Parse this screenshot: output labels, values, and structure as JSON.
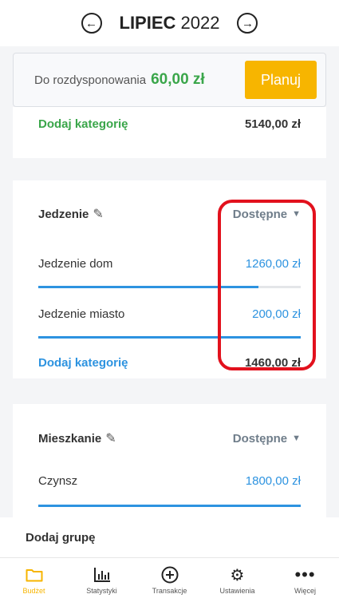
{
  "header": {
    "month": "LIPIEC",
    "year": "2022",
    "prev_icon": "arrow-left-circle-icon",
    "next_icon": "arrow-right-circle-icon"
  },
  "budget": {
    "label": "Do rozdysponowania",
    "amount": "60,00 zł",
    "plan_button": "Planuj"
  },
  "top_card": {
    "add_category": "Dodaj kategorię",
    "total": "5140,00 zł"
  },
  "groups": [
    {
      "name": "Jedzenie",
      "column_label": "Dostępne",
      "categories": [
        {
          "name": "Jedzenie dom",
          "amount": "1260,00 zł",
          "progress": 0.84
        },
        {
          "name": "Jedzenie miasto",
          "amount": "200,00 zł",
          "progress": 1.0
        }
      ],
      "add_category": "Dodaj kategorię",
      "total": "1460,00 zł"
    },
    {
      "name": "Mieszkanie",
      "column_label": "Dostępne",
      "categories": [
        {
          "name": "Czynsz",
          "amount": "1800,00 zł",
          "progress": 1.0
        }
      ]
    }
  ],
  "add_group": "Dodaj grupę",
  "tabs": [
    {
      "label": "Budżet",
      "icon": "folder-icon",
      "active": true
    },
    {
      "label": "Statystyki",
      "icon": "bar-chart-icon",
      "active": false
    },
    {
      "label": "Transakcje",
      "icon": "plus-circle-icon",
      "active": false
    },
    {
      "label": "Ustawienia",
      "icon": "gear-icon",
      "active": false
    },
    {
      "label": "Więcej",
      "icon": "more-dots-icon",
      "active": false
    }
  ],
  "colors": {
    "accent_green": "#3aa64a",
    "accent_blue": "#2d93e0",
    "accent_yellow": "#f7b500",
    "highlight_red": "#e2111d"
  }
}
